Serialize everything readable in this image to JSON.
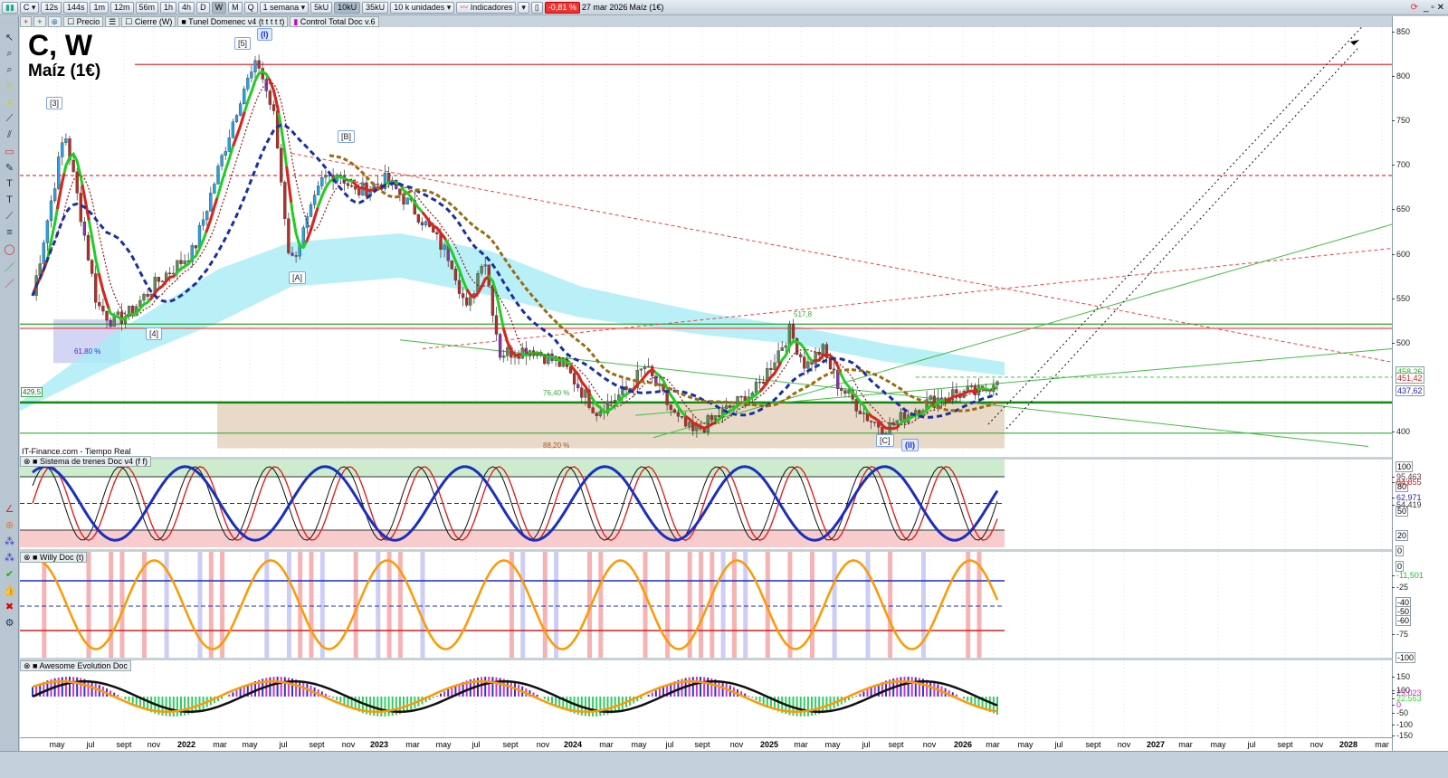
{
  "toolbar": {
    "symbol": "C",
    "intervals": [
      "12s",
      "144s",
      "1m",
      "12m",
      "56m",
      "1h",
      "4h",
      "D",
      "W",
      "M",
      "Q"
    ],
    "active_interval": "W",
    "period": "1 semana",
    "units": [
      "5kU",
      "10kU",
      "35kU"
    ],
    "active_unit": "10kU",
    "unit_select": "10 k unidades",
    "indicators_label": "Indicadores",
    "change_pct": "-0,81 %",
    "date": "27 mar 2026",
    "instrument": "Maíz (1€)"
  },
  "subbar": {
    "items": [
      "Precio",
      "Cierre (W)",
      "Tunel Domenec v4 (t t t t t)",
      "Control Total Doc v.6"
    ]
  },
  "main": {
    "title": "C, W",
    "subtitle": "Maíz (1€)",
    "source": "IT-Finance.com - Tiempo Real",
    "wave_labels": [
      "[5]",
      "(I)",
      "[3]",
      "[B]",
      "[A]",
      "[4]",
      "[C]",
      "(II)"
    ],
    "fib_labels": [
      "61,80 %",
      "76,40 %",
      "88,20 %"
    ],
    "level_labels": [
      "517,8",
      "429,5"
    ],
    "price_ticks": [
      "850",
      "800",
      "750",
      "700",
      "650",
      "600",
      "550",
      "500",
      "400"
    ],
    "price_tags": [
      {
        "value": "458,26",
        "color": "#22bb22"
      },
      {
        "value": "451,42",
        "color": "#cc2222"
      },
      {
        "value": "437,62",
        "color": "#2222bb"
      }
    ]
  },
  "panels": [
    {
      "title": "Sistema de trenes Doc v4 (f f)",
      "ticks": [
        "100",
        "80",
        "50",
        "20",
        "0"
      ],
      "tags": [
        {
          "value": "95,463",
          "color": "#444"
        },
        {
          "value": "84,855",
          "color": "#cc2222"
        },
        {
          "value": "62,971",
          "color": "#2222bb"
        },
        {
          "value": "54,419",
          "color": "#333"
        }
      ]
    },
    {
      "title": "Willy Doc (t)",
      "ticks": [
        "0",
        "-25",
        "-40",
        "-50",
        "-60",
        "-75",
        "-100"
      ],
      "tags": [
        {
          "value": "-11,501",
          "color": "#22bb22"
        }
      ]
    },
    {
      "title": "Awesome Evolution Doc",
      "ticks": [
        "150",
        "100",
        "-50",
        "-100",
        "-150"
      ],
      "tags": [
        {
          "value": "25,023",
          "color": "#cc22cc"
        },
        {
          "value": "22,563",
          "color": "#33dd33"
        },
        {
          "value": "0",
          "color": "#ee00ee"
        }
      ]
    }
  ],
  "time_axis": [
    "may",
    "jul",
    "sept",
    "nov",
    "2022",
    "mar",
    "may",
    "jul",
    "sept",
    "nov",
    "2023",
    "mar",
    "may",
    "jul",
    "sept",
    "nov",
    "2024",
    "mar",
    "may",
    "jul",
    "sept",
    "nov",
    "2025",
    "mar",
    "may",
    "jul",
    "sept",
    "nov",
    "2026",
    "mar",
    "may",
    "jul",
    "sept",
    "nov",
    "2027",
    "mar",
    "may",
    "jul",
    "sept",
    "nov",
    "2028",
    "mar"
  ],
  "chart_data": {
    "type": "candlestick",
    "title": "C, W — Maíz (1€)",
    "ylim": [
      370,
      860
    ],
    "keypoints": [
      [
        "2021-03",
        550
      ],
      [
        "2021-05",
        735
      ],
      [
        "2021-06",
        640
      ],
      [
        "2021-07",
        540
      ],
      [
        "2021-08",
        520
      ],
      [
        "2021-09",
        530
      ],
      [
        "2021-11",
        570
      ],
      [
        "2022-01",
        600
      ],
      [
        "2022-03",
        720
      ],
      [
        "2022-04",
        780
      ],
      [
        "2022-05",
        812
      ],
      [
        "2022-06",
        750
      ],
      [
        "2022-07",
        585
      ],
      [
        "2022-08",
        630
      ],
      [
        "2022-09",
        680
      ],
      [
        "2022-10",
        690
      ],
      [
        "2022-11",
        665
      ],
      [
        "2023-01",
        680
      ],
      [
        "2023-03",
        640
      ],
      [
        "2023-05",
        590
      ],
      [
        "2023-06",
        530
      ],
      [
        "2023-07",
        600
      ],
      [
        "2023-08",
        485
      ],
      [
        "2023-10",
        490
      ],
      [
        "2023-12",
        470
      ],
      [
        "2024-02",
        420
      ],
      [
        "2024-04",
        445
      ],
      [
        "2024-05",
        470
      ],
      [
        "2024-07",
        410
      ],
      [
        "2024-08",
        395
      ],
      [
        "2024-10",
        420
      ],
      [
        "2024-12",
        445
      ],
      [
        "2025-02",
        510
      ],
      [
        "2025-03",
        470
      ],
      [
        "2025-04",
        490
      ],
      [
        "2025-05",
        450
      ],
      [
        "2025-07",
        410
      ],
      [
        "2025-08",
        400
      ],
      [
        "2025-10",
        425
      ],
      [
        "2025-12",
        440
      ],
      [
        "2026-02",
        440
      ],
      [
        "2026-03",
        462
      ]
    ],
    "hlines": [
      {
        "value": 810,
        "style": "solid",
        "color": "#ee3333"
      },
      {
        "value": 685,
        "style": "dashed",
        "color": "#ee3333"
      },
      {
        "value": 513,
        "style": "solid",
        "color": "#ee3333"
      },
      {
        "value": 517.8,
        "style": "solid",
        "color": "#22aa22"
      },
      {
        "value": 429.5,
        "style": "solid",
        "color": "#118811"
      },
      {
        "value": 395,
        "style": "solid",
        "color": "#33aa33"
      },
      {
        "value": 458,
        "style": "dashed",
        "color": "#55cc55"
      }
    ]
  },
  "colors": {
    "accent": "#1a2fc0",
    "up": "#2ecc40",
    "down": "#e03030"
  }
}
